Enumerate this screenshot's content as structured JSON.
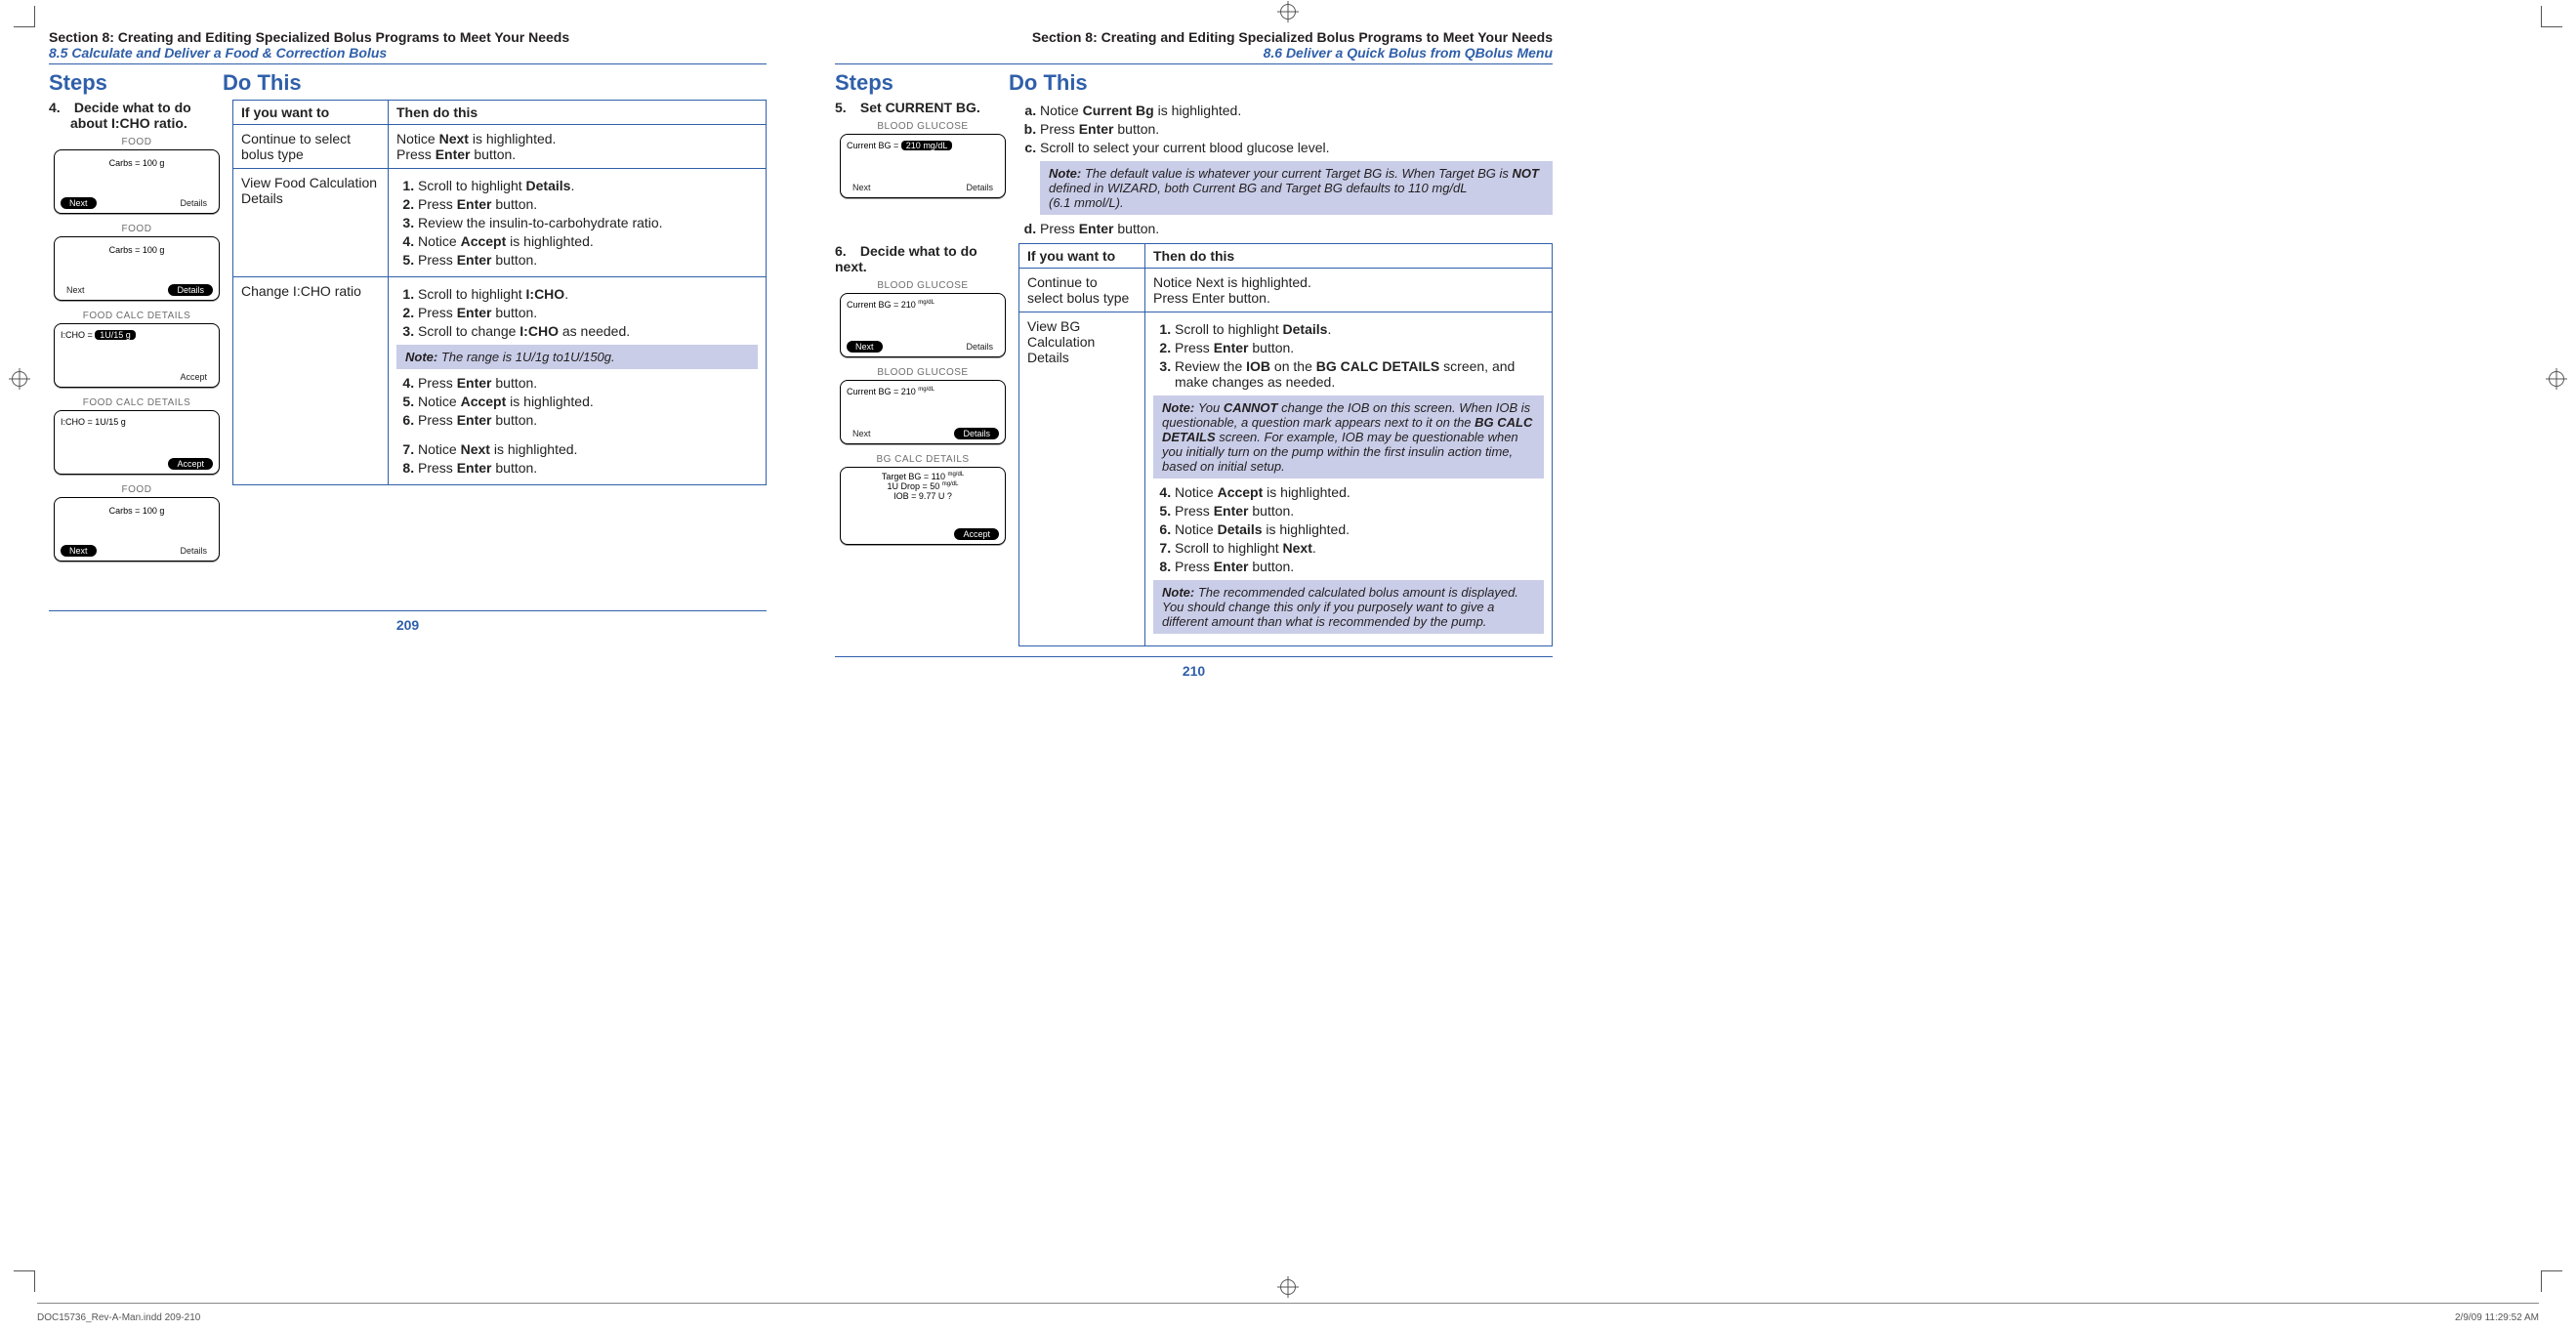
{
  "left": {
    "section_title": "Section 8: Creating and Editing Specialized Bolus Programs to Meet Your Needs",
    "subsection": "8.5 Calculate and Deliver a Food & Correction Bolus",
    "heads": {
      "steps": "Steps",
      "do": "Do This"
    },
    "step_num": "4.",
    "step_title_l1": "Decide what to do",
    "step_title_l2": "about I:CHO ratio.",
    "devs": {
      "food1": {
        "title": "FOOD",
        "line": "Carbs = 100 g",
        "left_pill": "Next",
        "right": "Details"
      },
      "food2": {
        "title": "FOOD",
        "line": "Carbs = 100 g",
        "left": "Next",
        "right_pill": "Details"
      },
      "fcd1": {
        "title": "FOOD CALC DETAILS",
        "line": "I:CHO =",
        "chip": "1U/15 g",
        "bottom_right": "Accept"
      },
      "fcd2": {
        "title": "FOOD CALC DETAILS",
        "line": "I:CHO = 1U/15 g",
        "bottom_pill": "Accept"
      },
      "food3": {
        "title": "FOOD",
        "line": "Carbs = 100 g",
        "left_pill": "Next",
        "right": "Details"
      }
    },
    "table": {
      "th1": "If you want to",
      "th2": "Then do this",
      "r1c1": "Continue to select bolus type",
      "r1c2": [
        "Notice <b>Next</b> is highlighted.",
        "Press <b>Enter</b> button."
      ],
      "r2c1": "View Food Calculation Details",
      "r2c2": [
        "Scroll to highlight <b>Details</b>.",
        "Press <b>Enter</b> button.",
        "Review the insulin-to-carbohydrate ratio.",
        "Notice <b>Accept</b> is highlighted.",
        "Press <b>Enter</b> button."
      ],
      "r3c1": "Change I:CHO ratio",
      "r3c2a": [
        "Scroll to highlight <b>I:CHO</b>.",
        "Press <b>Enter</b> button.",
        "Scroll to change <b>I:CHO</b> as needed."
      ],
      "r3note": "The range is 1U/1g to1U/150g.",
      "r3c2b": [
        "Press <b>Enter</b> button.",
        "Notice <b>Accept</b> is highlighted.",
        "Press <b>Enter</b> button."
      ],
      "r3c2c": [
        "Notice <b>Next</b> is highlighted.",
        "Press <b>Enter</b> button."
      ]
    },
    "page_num": "209"
  },
  "right": {
    "section_title": "Section 8: Creating and Editing Specialized Bolus Programs to Meet Your Needs",
    "subsection": "8.6 Deliver a Quick Bolus from QBolus Menu",
    "heads": {
      "steps": "Steps",
      "do": "Do This"
    },
    "s5": {
      "num": "5.",
      "title": "Set CURRENT BG.",
      "alpha": [
        "Notice <b>Current Bg</b> is highlighted.",
        "Press <b>Enter</b> button.",
        "Scroll to select your current blood glucose level."
      ],
      "note": "The default value is whatever your current Target BG is. When Target BG is <b><i>NOT</i></b> defined in WIZARD, both Current BG and Target BG defaults to 110 mg/dL (6.1 mmol/L).",
      "d": "Press <b>Enter</b> button.",
      "dev": {
        "title": "BLOOD GLUCOSE",
        "line": "Current BG =",
        "chip": "210 mg/dL",
        "left": "Next",
        "right": "Details"
      }
    },
    "s6": {
      "num": "6.",
      "title": "Decide what to do next.",
      "dev1": {
        "title": "BLOOD GLUCOSE",
        "line": "Current BG = 210 ",
        "unit": "mg/dL",
        "left_pill": "Next",
        "right": "Details"
      },
      "dev2": {
        "title": "BLOOD GLUCOSE",
        "line": "Current BG = 210 ",
        "unit": "mg/dL",
        "left": "Next",
        "right_pill": "Details"
      },
      "dev3": {
        "title": "BG CALC DETAILS",
        "l1": "Target BG = 110 ",
        "u1": "mg/dL",
        "l2": "1U Drop = 50 ",
        "u2": "mg/dL",
        "l3": "IOB = 9.77 U ?",
        "bottom_pill": "Accept"
      },
      "table": {
        "th1": "If you want to",
        "th2": "Then do this",
        "r1c1": "Continue to select bolus type",
        "r1c2": [
          "Notice Next is highlighted.",
          "Press Enter button."
        ],
        "r2c1": "View BG Calculation Details",
        "r2c2a": [
          "Scroll to highlight <b>Details</b>.",
          "Press <b>Enter</b> button.",
          "Review the <b>IOB</b> on the <b>BG CALC DETAILS</b> screen, and make changes as needed."
        ],
        "note1": "You <b><i>CANNOT</i></b> change the IOB on this screen. When IOB is questionable, a question mark appears next to it on the <b><i>BG CALC DETAILS</i></b> screen. For example, IOB may be questionable when you initially turn on the pump within the first insulin action time, based on initial setup.",
        "r2c2b": [
          "Notice <b>Accept</b> is highlighted.",
          "Press <b>Enter</b> button.",
          "Notice <b>Details</b> is highlighted.",
          "Scroll to highlight <b>Next</b>.",
          "Press <b>Enter</b> button."
        ],
        "note2": "The recommended calculated bolus amount is displayed. You should change this only if you purposely want to give a different amount than what is recommended by the pump."
      }
    },
    "page_num": "210"
  },
  "slug": {
    "file": "DOC15736_Rev-A-Man.indd   209-210",
    "stamp": "2/9/09   11:29:52 AM"
  }
}
